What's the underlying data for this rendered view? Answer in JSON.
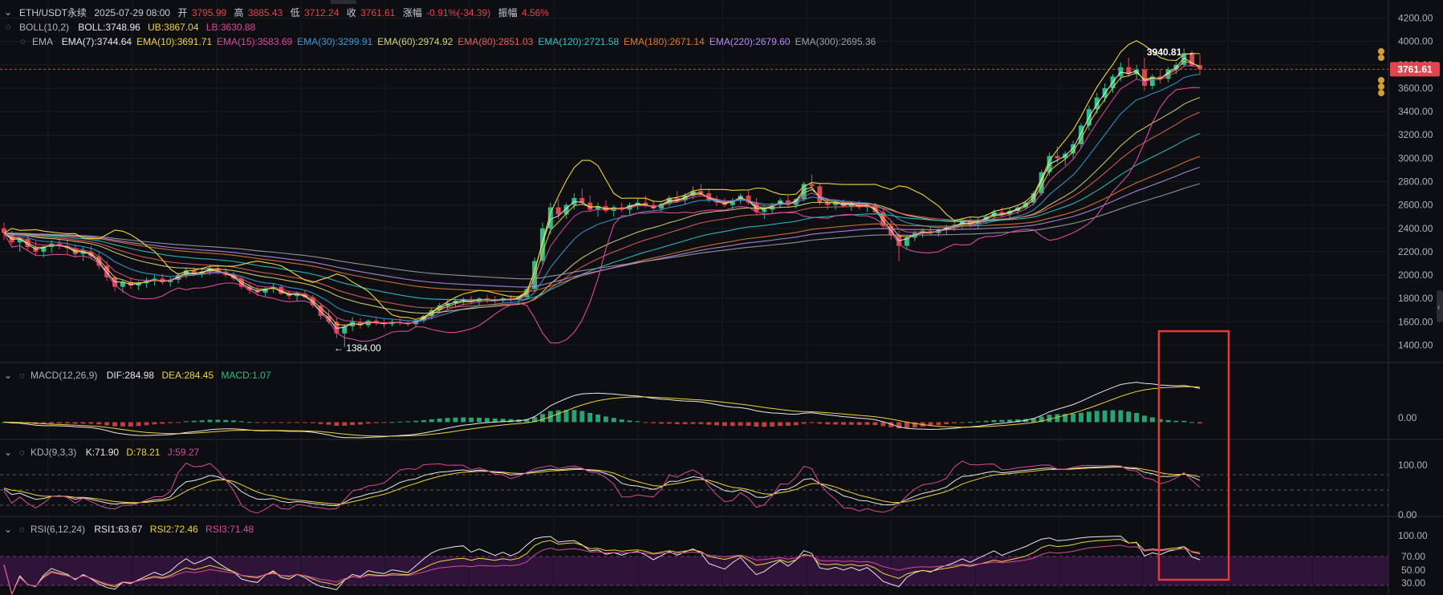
{
  "header": {
    "symbol": "ETH/USDT永续",
    "datetime": "2025-07-29 08:00",
    "open_label": "开",
    "open": "3795.99",
    "high_label": "高",
    "high": "3885.43",
    "low_label": "低",
    "low": "3712.24",
    "close_label": "收",
    "close": "3761.61",
    "change_label": "涨幅",
    "change": "-0.91%(-34.39)",
    "amp_label": "振幅",
    "amp": "4.56%"
  },
  "boll": {
    "name": "BOLL(10,2)",
    "mid": "BOLL:3748.96",
    "ub": "UB:3867.04",
    "lb": "LB:3630.88"
  },
  "ema": {
    "name": "EMA",
    "items": [
      {
        "label": "EMA(7):3744.64",
        "color": "#e8e8e8"
      },
      {
        "label": "EMA(10):3691.71",
        "color": "#f1d33b"
      },
      {
        "label": "EMA(15):3583.69",
        "color": "#d9499f"
      },
      {
        "label": "EMA(30):3299.91",
        "color": "#3c9ad8"
      },
      {
        "label": "EMA(60):2974.92",
        "color": "#d8d47a"
      },
      {
        "label": "EMA(80):2851.03",
        "color": "#e0645c"
      },
      {
        "label": "EMA(120):2721.58",
        "color": "#2fc4c7"
      },
      {
        "label": "EMA(180):2671.14",
        "color": "#e07a30"
      },
      {
        "label": "EMA(220):2679.60",
        "color": "#b48cf0"
      },
      {
        "label": "EMA(300):2695.36",
        "color": "#9aa0a8"
      }
    ]
  },
  "macd": {
    "name": "MACD(12,26,9)",
    "dif": "DIF:284.98",
    "dea": "DEA:284.45",
    "macd": "MACD:1.07"
  },
  "kdj": {
    "name": "KDJ(9,3,3)",
    "k": "K:71.90",
    "d": "D:78.21",
    "j": "J:59.27"
  },
  "rsi": {
    "name": "RSI(6,12,24)",
    "r1": "RSI1:63.67",
    "r2": "RSI2:72.46",
    "r3": "RSI3:71.48"
  },
  "price_axis": [
    "4200.00",
    "4000.00",
    "3800.00",
    "3600.00",
    "3400.00",
    "3200.00",
    "3000.00",
    "2800.00",
    "2600.00",
    "2400.00",
    "2200.00",
    "2000.00",
    "1800.00",
    "1600.00",
    "1400.00"
  ],
  "current_price_tag": "3761.61",
  "macd_axis": [
    "0.00"
  ],
  "kdj_axis": [
    "100.00",
    "0.00"
  ],
  "rsi_axis": [
    "100.00",
    "70.00",
    "50.00",
    "30.00"
  ],
  "annotations": {
    "high": "3940.81 →",
    "low": "← 1384.00"
  },
  "colors": {
    "up": "#2ebd85",
    "down": "#e0464e",
    "bg": "#0d0e11",
    "highlight": "#e53935"
  },
  "chart_data": {
    "type": "candlestick",
    "title": "ETH/USDT永续",
    "ylim": [
      1300,
      4300
    ],
    "candles": [
      [
        2400,
        2450,
        2300,
        2360
      ],
      [
        2360,
        2380,
        2260,
        2280
      ],
      [
        2280,
        2320,
        2200,
        2310
      ],
      [
        2310,
        2350,
        2220,
        2240
      ],
      [
        2240,
        2290,
        2170,
        2200
      ],
      [
        2200,
        2260,
        2150,
        2240
      ],
      [
        2240,
        2300,
        2190,
        2270
      ],
      [
        2270,
        2310,
        2220,
        2250
      ],
      [
        2250,
        2300,
        2180,
        2230
      ],
      [
        2230,
        2260,
        2150,
        2180
      ],
      [
        2180,
        2240,
        2120,
        2200
      ],
      [
        2200,
        2250,
        2140,
        2160
      ],
      [
        2160,
        2200,
        2050,
        2080
      ],
      [
        2080,
        2120,
        1950,
        1980
      ],
      [
        1980,
        2000,
        1860,
        1900
      ],
      [
        1900,
        1960,
        1850,
        1940
      ],
      [
        1940,
        1980,
        1880,
        1910
      ],
      [
        1910,
        1950,
        1870,
        1930
      ],
      [
        1930,
        1980,
        1890,
        1950
      ],
      [
        1950,
        2000,
        1910,
        1970
      ],
      [
        1970,
        2010,
        1920,
        1940
      ],
      [
        1940,
        1980,
        1900,
        1960
      ],
      [
        1960,
        2020,
        1930,
        2000
      ],
      [
        2000,
        2060,
        1970,
        2040
      ],
      [
        2040,
        2070,
        1990,
        2010
      ],
      [
        2010,
        2050,
        1980,
        2030
      ],
      [
        2030,
        2080,
        2000,
        2060
      ],
      [
        2060,
        2090,
        2010,
        2030
      ],
      [
        2030,
        2060,
        1980,
        2000
      ],
      [
        2000,
        2030,
        1950,
        1970
      ],
      [
        1970,
        1990,
        1880,
        1900
      ],
      [
        1900,
        1930,
        1840,
        1870
      ],
      [
        1870,
        1900,
        1820,
        1850
      ],
      [
        1850,
        1900,
        1820,
        1880
      ],
      [
        1880,
        1930,
        1850,
        1900
      ],
      [
        1900,
        1920,
        1830,
        1840
      ],
      [
        1840,
        1870,
        1790,
        1820
      ],
      [
        1820,
        1860,
        1780,
        1840
      ],
      [
        1840,
        1870,
        1800,
        1810
      ],
      [
        1810,
        1830,
        1720,
        1740
      ],
      [
        1740,
        1760,
        1620,
        1650
      ],
      [
        1650,
        1700,
        1580,
        1600
      ],
      [
        1600,
        1640,
        1460,
        1500
      ],
      [
        1500,
        1580,
        1384,
        1560
      ],
      [
        1560,
        1640,
        1520,
        1600
      ],
      [
        1600,
        1630,
        1540,
        1570
      ],
      [
        1570,
        1620,
        1550,
        1610
      ],
      [
        1610,
        1640,
        1570,
        1590
      ],
      [
        1590,
        1620,
        1550,
        1580
      ],
      [
        1580,
        1620,
        1560,
        1600
      ],
      [
        1600,
        1630,
        1570,
        1590
      ],
      [
        1590,
        1610,
        1560,
        1580
      ],
      [
        1580,
        1620,
        1560,
        1610
      ],
      [
        1610,
        1660,
        1590,
        1650
      ],
      [
        1650,
        1720,
        1620,
        1700
      ],
      [
        1700,
        1760,
        1680,
        1740
      ],
      [
        1740,
        1790,
        1700,
        1760
      ],
      [
        1760,
        1800,
        1720,
        1780
      ],
      [
        1780,
        1810,
        1740,
        1790
      ],
      [
        1790,
        1820,
        1750,
        1770
      ],
      [
        1770,
        1810,
        1740,
        1800
      ],
      [
        1800,
        1830,
        1760,
        1790
      ],
      [
        1790,
        1820,
        1750,
        1780
      ],
      [
        1780,
        1810,
        1760,
        1800
      ],
      [
        1800,
        1830,
        1770,
        1790
      ],
      [
        1790,
        1820,
        1760,
        1810
      ],
      [
        1810,
        1900,
        1790,
        1880
      ],
      [
        1880,
        2150,
        1860,
        2120
      ],
      [
        2120,
        2450,
        2080,
        2400
      ],
      [
        2400,
        2620,
        2350,
        2580
      ],
      [
        2580,
        2650,
        2480,
        2520
      ],
      [
        2520,
        2620,
        2480,
        2600
      ],
      [
        2600,
        2700,
        2560,
        2660
      ],
      [
        2660,
        2740,
        2600,
        2620
      ],
      [
        2620,
        2680,
        2540,
        2560
      ],
      [
        2560,
        2620,
        2500,
        2590
      ],
      [
        2590,
        2640,
        2530,
        2550
      ],
      [
        2550,
        2600,
        2500,
        2580
      ],
      [
        2580,
        2620,
        2540,
        2560
      ],
      [
        2560,
        2620,
        2520,
        2600
      ],
      [
        2600,
        2660,
        2560,
        2620
      ],
      [
        2620,
        2680,
        2580,
        2600
      ],
      [
        2600,
        2640,
        2550,
        2570
      ],
      [
        2570,
        2620,
        2540,
        2610
      ],
      [
        2610,
        2680,
        2590,
        2660
      ],
      [
        2660,
        2720,
        2620,
        2640
      ],
      [
        2640,
        2700,
        2610,
        2680
      ],
      [
        2680,
        2760,
        2650,
        2720
      ],
      [
        2720,
        2780,
        2680,
        2700
      ],
      [
        2700,
        2740,
        2620,
        2640
      ],
      [
        2640,
        2680,
        2590,
        2620
      ],
      [
        2620,
        2660,
        2580,
        2600
      ],
      [
        2600,
        2660,
        2560,
        2640
      ],
      [
        2640,
        2700,
        2610,
        2680
      ],
      [
        2680,
        2720,
        2600,
        2620
      ],
      [
        2620,
        2660,
        2520,
        2540
      ],
      [
        2540,
        2600,
        2480,
        2560
      ],
      [
        2560,
        2620,
        2530,
        2600
      ],
      [
        2600,
        2660,
        2570,
        2640
      ],
      [
        2640,
        2680,
        2580,
        2600
      ],
      [
        2600,
        2660,
        2570,
        2650
      ],
      [
        2650,
        2800,
        2630,
        2780
      ],
      [
        2780,
        2860,
        2740,
        2760
      ],
      [
        2760,
        2790,
        2600,
        2620
      ],
      [
        2620,
        2660,
        2560,
        2600
      ],
      [
        2600,
        2640,
        2560,
        2620
      ],
      [
        2620,
        2650,
        2580,
        2590
      ],
      [
        2590,
        2630,
        2550,
        2610
      ],
      [
        2610,
        2640,
        2560,
        2580
      ],
      [
        2580,
        2620,
        2540,
        2600
      ],
      [
        2600,
        2620,
        2520,
        2540
      ],
      [
        2540,
        2580,
        2400,
        2420
      ],
      [
        2420,
        2460,
        2300,
        2340
      ],
      [
        2340,
        2380,
        2120,
        2250
      ],
      [
        2250,
        2340,
        2220,
        2320
      ],
      [
        2320,
        2380,
        2290,
        2360
      ],
      [
        2360,
        2400,
        2320,
        2380
      ],
      [
        2380,
        2420,
        2340,
        2360
      ],
      [
        2360,
        2400,
        2330,
        2390
      ],
      [
        2390,
        2430,
        2350,
        2410
      ],
      [
        2410,
        2460,
        2380,
        2430
      ],
      [
        2430,
        2480,
        2400,
        2460
      ],
      [
        2460,
        2500,
        2410,
        2440
      ],
      [
        2440,
        2490,
        2400,
        2470
      ],
      [
        2470,
        2520,
        2440,
        2500
      ],
      [
        2500,
        2560,
        2470,
        2540
      ],
      [
        2540,
        2580,
        2500,
        2520
      ],
      [
        2520,
        2570,
        2490,
        2550
      ],
      [
        2550,
        2600,
        2520,
        2580
      ],
      [
        2580,
        2640,
        2560,
        2620
      ],
      [
        2620,
        2720,
        2600,
        2700
      ],
      [
        2700,
        2900,
        2680,
        2880
      ],
      [
        2880,
        3050,
        2850,
        3020
      ],
      [
        3020,
        3100,
        2960,
        3000
      ],
      [
        3000,
        3060,
        2940,
        3040
      ],
      [
        3040,
        3150,
        3000,
        3120
      ],
      [
        3120,
        3300,
        3080,
        3280
      ],
      [
        3280,
        3450,
        3240,
        3420
      ],
      [
        3420,
        3560,
        3380,
        3520
      ],
      [
        3520,
        3640,
        3480,
        3600
      ],
      [
        3600,
        3720,
        3560,
        3700
      ],
      [
        3700,
        3820,
        3660,
        3780
      ],
      [
        3780,
        3860,
        3700,
        3720
      ],
      [
        3720,
        3800,
        3680,
        3760
      ],
      [
        3760,
        3860,
        3580,
        3620
      ],
      [
        3620,
        3720,
        3590,
        3700
      ],
      [
        3700,
        3760,
        3640,
        3680
      ],
      [
        3680,
        3780,
        3650,
        3760
      ],
      [
        3760,
        3820,
        3720,
        3800
      ],
      [
        3800,
        3940.81,
        3780,
        3900
      ],
      [
        3900,
        3920,
        3780,
        3796
      ],
      [
        3795.99,
        3885.43,
        3712.24,
        3761.61
      ]
    ],
    "macd_hist_range": [
      -120,
      300
    ],
    "kdj_range": [
      -10,
      110
    ],
    "rsi_range": [
      0,
      110
    ]
  }
}
